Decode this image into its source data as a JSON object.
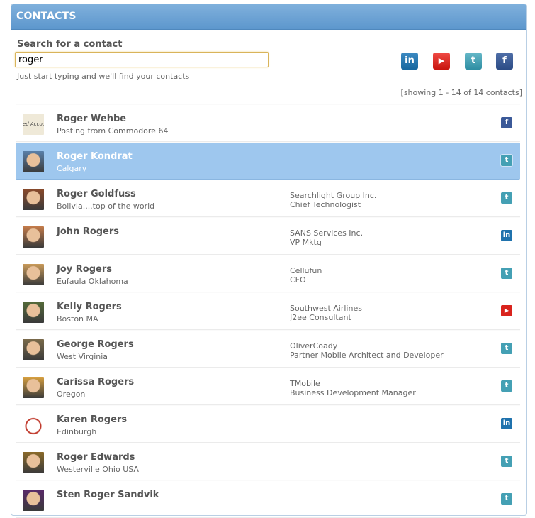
{
  "panel": {
    "title": "CONTACTS"
  },
  "search": {
    "label": "Search for a contact",
    "value": "roger",
    "hint": "Just start typing and we'll find your contacts"
  },
  "networks": [
    {
      "name": "linkedin-icon",
      "glyph": "in"
    },
    {
      "name": "youtube-icon",
      "glyph": "▶"
    },
    {
      "name": "twitter-icon",
      "glyph": "t"
    },
    {
      "name": "facebook-icon",
      "glyph": "f"
    }
  ],
  "showing": "[showing 1 - 14 of 14 contacts]",
  "contacts": [
    {
      "name": "Roger Wehbe",
      "location": "Posting from Commodore 64",
      "org": "",
      "role": "",
      "network": "facebook",
      "avatar_text": "ed Accou"
    },
    {
      "name": "Roger Kondrat",
      "location": "Calgary",
      "org": "",
      "role": "",
      "network": "twitter",
      "selected": true
    },
    {
      "name": "Roger Goldfuss",
      "location": "Bolivia....top of the world",
      "org": "Searchlight Group Inc.",
      "role": "Chief Technologist",
      "network": "twitter"
    },
    {
      "name": "John Rogers",
      "location": "",
      "org": "SANS Services Inc.",
      "role": "VP Mktg",
      "network": "linkedin"
    },
    {
      "name": "Joy Rogers",
      "location": "Eufaula Oklahoma",
      "org": "Cellufun",
      "role": "CFO",
      "network": "twitter"
    },
    {
      "name": "Kelly Rogers",
      "location": "Boston MA",
      "org": "Southwest Airlines",
      "role": "J2ee Consultant",
      "network": "youtube"
    },
    {
      "name": "George Rogers",
      "location": "West Virginia",
      "org": "OliverCoady",
      "role": "Partner Mobile Architect and Developer",
      "network": "twitter"
    },
    {
      "name": "Carissa Rogers",
      "location": "Oregon",
      "org": "TMobile",
      "role": "Business Development Manager",
      "network": "twitter"
    },
    {
      "name": "Karen Rogers",
      "location": "Edinburgh",
      "org": "",
      "role": "",
      "network": "linkedin"
    },
    {
      "name": "Roger Edwards",
      "location": "Westerville Ohio USA",
      "org": "",
      "role": "",
      "network": "twitter"
    },
    {
      "name": "Sten Roger Sandvik",
      "location": "",
      "org": "",
      "role": "",
      "network": "twitter"
    }
  ],
  "colors": {
    "header": "#6aa3d6",
    "selected_row": "#9ec7ee",
    "linkedin": "#1f72ad",
    "youtube": "#d9231d",
    "twitter": "#44a0b4",
    "facebook": "#3b5998"
  }
}
